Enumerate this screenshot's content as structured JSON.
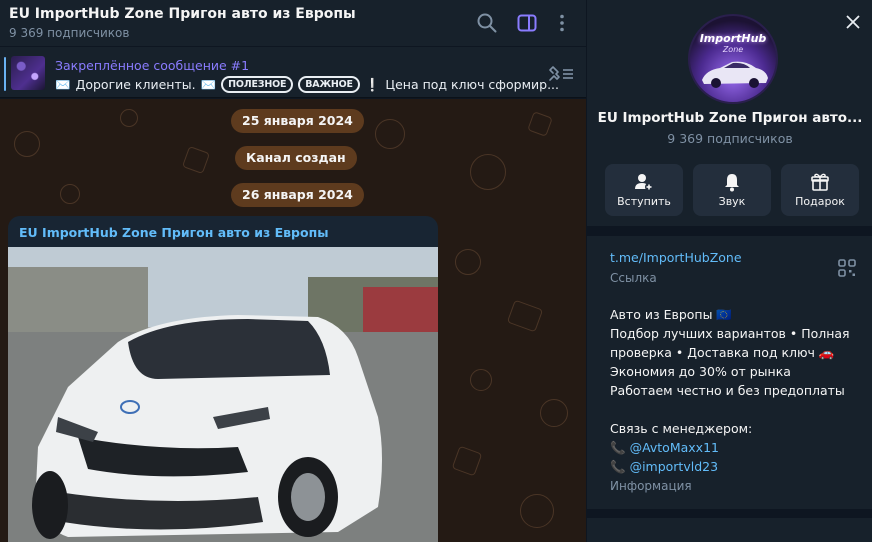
{
  "header": {
    "title": "EU ImportHub Zone Пригон авто из Европы",
    "subscribers": "9 369 подписчиков"
  },
  "pinned": {
    "title": "Закреплённое сообщение #1",
    "text_start": "Дорогие клиенты.",
    "chip1": "ПОЛЕЗНОЕ",
    "chip2": "ВАЖНОЕ",
    "text_end": "Цена под ключ сформир..."
  },
  "messages": {
    "date1": "25 января 2024",
    "service": "Канал создан",
    "date2": "26 января 2024",
    "post_author": "EU ImportHub Zone Пригон авто из Европы"
  },
  "info": {
    "avatar_brand": "ImportHub",
    "avatar_zone": "Zone",
    "name": "EU ImportHub Zone Пригон авто...",
    "subscribers": "9 369 подписчиков",
    "actions": {
      "join": "Вступить",
      "sound": "Звук",
      "gift": "Подарок"
    },
    "link": "t.me/ImportHubZone",
    "link_caption": "Ссылка",
    "description": [
      "Авто из Европы 🇪🇺",
      "Подбор лучших вариантов • Полная",
      "проверка • Доставка под ключ 🚗",
      "Экономия до 30% от рынка",
      "Работаем честно и без предоплаты",
      "",
      "Связь с менеджером:"
    ],
    "contact1": "@AvtoMaxx11",
    "contact2": "@importvld23",
    "info_caption": "Информация"
  },
  "colors": {
    "accent": "#62bcf9",
    "pin_title": "#8a7cff",
    "date_pill": "#5e3b1e",
    "panel_bg": "#17212b",
    "chat_bg": "#241a14"
  }
}
